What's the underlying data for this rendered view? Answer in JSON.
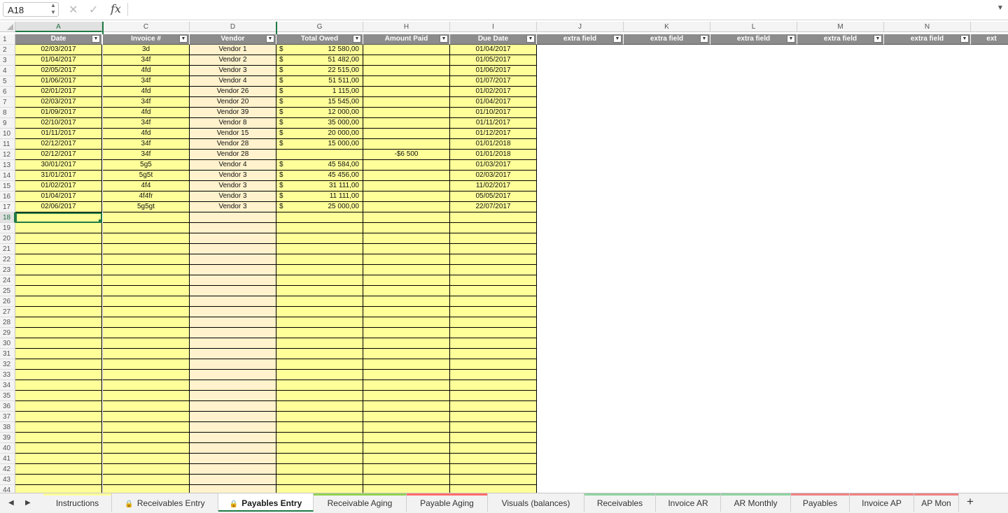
{
  "formula_bar": {
    "name_box": "A18",
    "fx_label": "fx",
    "content": ""
  },
  "columns": [
    "A",
    "C",
    "D",
    "G",
    "H",
    "I",
    "J",
    "K",
    "L",
    "M",
    "N"
  ],
  "headers": [
    "Date",
    "Invoice #",
    "Vendor",
    "Total Owed",
    "Amount Paid",
    "Due Date",
    "extra field",
    "extra field",
    "extra field",
    "extra field",
    "extra field",
    "ext"
  ],
  "rows": [
    [
      "02/03/2017",
      "3d",
      "Vendor 1",
      "$",
      "12 580,00",
      "",
      "01/04/2017"
    ],
    [
      "01/04/2017",
      "34f",
      "Vendor 2",
      "$",
      "51 482,00",
      "",
      "01/05/2017"
    ],
    [
      "02/05/2017",
      "4fd",
      "Vendor 3",
      "$",
      "22 515,00",
      "",
      "01/06/2017"
    ],
    [
      "01/06/2017",
      "34f",
      "Vendor 4",
      "$",
      "51 511,00",
      "",
      "01/07/2017"
    ],
    [
      "02/01/2017",
      "4fd",
      "Vendor 26",
      "$",
      "1 115,00",
      "",
      "01/02/2017"
    ],
    [
      "02/03/2017",
      "34f",
      "Vendor 20",
      "$",
      "15 545,00",
      "",
      "01/04/2017"
    ],
    [
      "01/09/2017",
      "4fd",
      "Vendor 39",
      "$",
      "12 000,00",
      "",
      "01/10/2017"
    ],
    [
      "02/10/2017",
      "34f",
      "Vendor 8",
      "$",
      "35 000,00",
      "",
      "01/11/2017"
    ],
    [
      "01/11/2017",
      "4fd",
      "Vendor 15",
      "$",
      "20 000,00",
      "",
      "01/12/2017"
    ],
    [
      "02/12/2017",
      "34f",
      "Vendor 28",
      "$",
      "15 000,00",
      "",
      "01/01/2018"
    ],
    [
      "02/12/2017",
      "34f",
      "Vendor 28",
      "",
      "",
      "-$6 500",
      "01/01/2018"
    ],
    [
      "30/01/2017",
      "5g5",
      "Vendor 4",
      "$",
      "45 584,00",
      "",
      "01/03/2017"
    ],
    [
      "31/01/2017",
      "5g5t",
      "Vendor 3",
      "$",
      "45 456,00",
      "",
      "02/03/2017"
    ],
    [
      "01/02/2017",
      "4f4",
      "Vendor 3",
      "$",
      "31 111,00",
      "",
      "11/02/2017"
    ],
    [
      "01/04/2017",
      "4f4fr",
      "Vendor 3",
      "$",
      "11 111,00",
      "",
      "05/05/2017"
    ],
    [
      "02/06/2017",
      "5g5gt",
      "Vendor 3",
      "$",
      "25 000,00",
      "",
      "22/07/2017"
    ]
  ],
  "row_numbers": [
    "1",
    "2",
    "3",
    "4",
    "5",
    "6",
    "7",
    "8",
    "9",
    "10",
    "11",
    "12",
    "13",
    "14",
    "15",
    "16",
    "17",
    "18",
    "19",
    "20",
    "21",
    "22",
    "23",
    "24",
    "25",
    "26",
    "27",
    "28",
    "29",
    "30",
    "31",
    "32",
    "33",
    "34",
    "35",
    "36",
    "37",
    "38",
    "39",
    "40",
    "41",
    "42",
    "43",
    "44"
  ],
  "tabs": [
    {
      "label": "Instructions",
      "locked": false,
      "stripe": "#ffff99",
      "active": false
    },
    {
      "label": "Receivables Entry",
      "locked": true,
      "stripe": "",
      "active": false
    },
    {
      "label": "Payables Entry",
      "locked": true,
      "stripe": "",
      "active": true
    },
    {
      "label": "Receivable Aging",
      "locked": false,
      "stripe": "#92d050",
      "active": false
    },
    {
      "label": "Payable Aging",
      "locked": false,
      "stripe": "#ff6b6b",
      "active": false
    },
    {
      "label": "Visuals (balances)",
      "locked": false,
      "stripe": "",
      "active": false
    },
    {
      "label": "Receivables",
      "locked": false,
      "stripe": "#8fd3a0",
      "active": false
    },
    {
      "label": "Invoice AR",
      "locked": false,
      "stripe": "#8fd3a0",
      "active": false
    },
    {
      "label": "AR Monthly",
      "locked": false,
      "stripe": "#8fd3a0",
      "active": false
    },
    {
      "label": "Payables",
      "locked": false,
      "stripe": "#f08080",
      "active": false
    },
    {
      "label": "Invoice AP",
      "locked": false,
      "stripe": "#f08080",
      "active": false
    },
    {
      "label": "AP Mon",
      "locked": false,
      "stripe": "#f08080",
      "active": false
    }
  ],
  "add_sheet": "+",
  "colors": {
    "accent": "#1f7a45",
    "yellow": "#ffff99",
    "cream": "#fff2cc",
    "header_gray": "#8c8c8c"
  }
}
